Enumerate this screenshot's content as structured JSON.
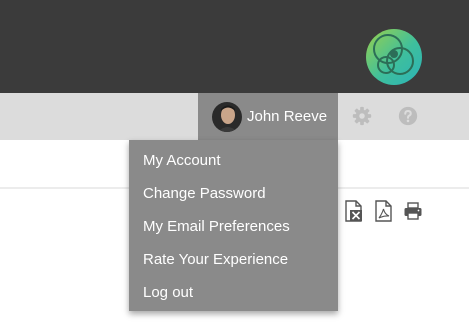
{
  "header": {
    "logo_icon": "app-logo",
    "bg_color": "#3b3b3b"
  },
  "nav": {
    "user_name": "John Reeve",
    "avatar_icon": "user-avatar",
    "settings_icon": "gear-icon",
    "help_icon": "help-icon",
    "bg_color": "#dcdcdc",
    "active_color": "#8a8a8a"
  },
  "user_menu": {
    "items": [
      {
        "label": "My Account"
      },
      {
        "label": "Change Password"
      },
      {
        "label": "My Email Preferences"
      },
      {
        "label": "Rate Your Experience"
      },
      {
        "label": "Log out"
      }
    ]
  },
  "export_toolbar": {
    "icons": [
      "excel-icon",
      "pdf-icon",
      "print-icon"
    ]
  }
}
